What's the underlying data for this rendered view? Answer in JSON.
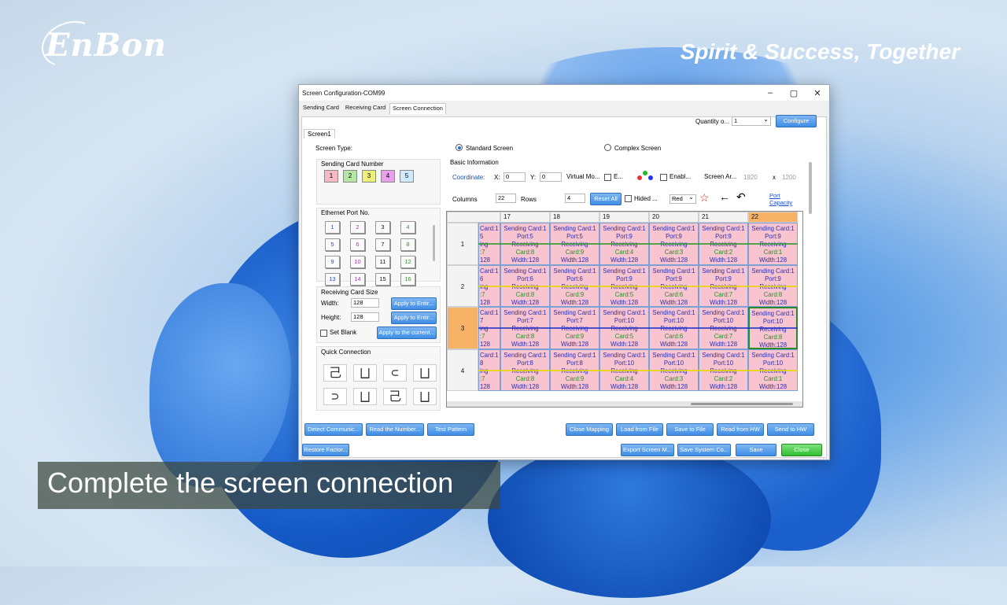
{
  "branding": {
    "logo": "EnBon",
    "tagline": "Spirit & Success, Together"
  },
  "subtitle": "Complete the screen connection",
  "window": {
    "title": "Screen Configuration-COM99",
    "minimize": "–",
    "maximize": "▢",
    "close": "✕",
    "tabs": [
      "Sending Card",
      "Receiving Card",
      "Screen Connection"
    ],
    "active_tab": 2
  },
  "top": {
    "quantity_label": "Quantity o...",
    "quantity_value": "1",
    "configure": "Configure",
    "screen_tab": "Screen1"
  },
  "screen_type": {
    "label": "Screen Type:",
    "standard": "Standard Screen",
    "complex": "Complex Screen"
  },
  "sending_card": {
    "label": "Sending Card Number",
    "numbers": [
      "1",
      "2",
      "3",
      "4",
      "5"
    ],
    "colors": [
      "#f8b8c4",
      "#b6e6a4",
      "#eef07a",
      "#e7a0ec",
      "#cfe9ff"
    ]
  },
  "ethernet": {
    "label": "Ethernet Port No.",
    "ports": [
      "1",
      "2",
      "3",
      "4",
      "5",
      "6",
      "7",
      "8",
      "9",
      "10",
      "11",
      "12",
      "13",
      "14",
      "15",
      "16"
    ],
    "colors": [
      "#1d4fd6",
      "#c22bd0",
      "#111",
      "#2a9a2a",
      "#1d4fd6",
      "#c22bd0",
      "#111",
      "#2a9a2a",
      "#1d4fd6",
      "#c22bd0",
      "#111",
      "#2a9a2a",
      "#1d4fd6",
      "#c22bd0",
      "#111",
      "#2a9a2a"
    ]
  },
  "rc_size": {
    "label": "Receiving Card Size",
    "width_label": "Width:",
    "width": "128",
    "height_label": "Height:",
    "height": "128",
    "apply_entire": "Apply to Entir...",
    "set_blank": "Set Blank",
    "apply_current": "Apply to the current..."
  },
  "quick": {
    "label": "Quick Connection",
    "glyphs": [
      "己",
      "⨆",
      "⊂",
      "⨆",
      "⊃",
      "⨆",
      "己",
      "⨆"
    ]
  },
  "basic": {
    "label": "Basic Information",
    "coordinate": "Coordinate:",
    "x_label": "X:",
    "x": "0",
    "y_label": "Y:",
    "y": "0",
    "virtual": "Virtual Mo...",
    "e": "E...",
    "enable": "Enabl...",
    "screen_area": "Screen Ar...",
    "sw": "1920",
    "x_sep": "x",
    "sh": "1200",
    "columns_label": "Columns",
    "columns": "22",
    "rows_label": "Rows",
    "rows": "4",
    "reset_all": "Reset All",
    "hided": "Hided ...",
    "color_sel": "Red",
    "port_capacity": "Port Capacity"
  },
  "grid": {
    "col_headers": [
      "",
      "17",
      "18",
      "19",
      "20",
      "21",
      "22"
    ],
    "row_headers": [
      "1",
      "2",
      "3",
      "4"
    ],
    "rows": [
      [
        [
          "Card:1",
          "5",
          "ing",
          ":7",
          "128"
        ],
        [
          "Sending Card:1",
          "Port:5",
          "Receiving",
          "Card:8",
          "Width:128"
        ],
        [
          "Sending Card:1",
          "Port:5",
          "Receiving",
          "Card:9",
          "Width:128"
        ],
        [
          "Sending Card:1",
          "Port:9",
          "Receiving",
          "Card:4",
          "Width:128"
        ],
        [
          "Sending Card:1",
          "Port:9",
          "Receiving",
          "Card:3",
          "Width:128"
        ],
        [
          "Sending Card:1",
          "Port:9",
          "Receiving",
          "Card:2",
          "Width:128"
        ],
        [
          "Sending Card:1",
          "Port:9",
          "Receiving",
          "Card:1",
          "Width:128"
        ]
      ],
      [
        [
          "Card:1",
          "6",
          "ing",
          ":7",
          "128"
        ],
        [
          "Sending Card:1",
          "Port:6",
          "Receiving",
          "Card:8",
          "Width:128"
        ],
        [
          "Sending Card:1",
          "Port:6",
          "Receiving",
          "Card:9",
          "Width:128"
        ],
        [
          "Sending Card:1",
          "Port:9",
          "Receiving",
          "Card:5",
          "Width:128"
        ],
        [
          "Sending Card:1",
          "Port:9",
          "Receiving",
          "Card:6",
          "Width:128"
        ],
        [
          "Sending Card:1",
          "Port:9",
          "Receiving",
          "Card:7",
          "Width:128"
        ],
        [
          "Sending Card:1",
          "Port:9",
          "Receiving",
          "Card:8",
          "Width:128"
        ]
      ],
      [
        [
          "Card:1",
          "7",
          "ing",
          ":7",
          "128"
        ],
        [
          "Sending Card:1",
          "Port:7",
          "Receiving",
          "Card:8",
          "Width:128"
        ],
        [
          "Sending Card:1",
          "Port:7",
          "Receiving",
          "Card:9",
          "Width:128"
        ],
        [
          "Sending Card:1",
          "Port:10",
          "Receiving",
          "Card:5",
          "Width:128"
        ],
        [
          "Sending Card:1",
          "Port:10",
          "Receiving",
          "Card:6",
          "Width:128"
        ],
        [
          "Sending Card:1",
          "Port:10",
          "Receiving",
          "Card:7",
          "Width:128"
        ],
        [
          "Sending Card:1",
          "Port:10",
          "Receiving",
          "Card:8",
          "Width:128"
        ]
      ],
      [
        [
          "Card:1",
          "8",
          "ing",
          ":7",
          "128"
        ],
        [
          "Sending Card:1",
          "Port:8",
          "Receiving",
          "Card:8",
          "Width:128"
        ],
        [
          "Sending Card:1",
          "Port:8",
          "Receiving",
          "Card:9",
          "Width:128"
        ],
        [
          "Sending Card:1",
          "Port:10",
          "Receiving",
          "Card:4",
          "Width:128"
        ],
        [
          "Sending Card:1",
          "Port:10",
          "Receiving",
          "Card:3",
          "Width:128"
        ],
        [
          "Sending Card:1",
          "Port:10",
          "Receiving",
          "Card:2",
          "Width:128"
        ],
        [
          "Sending Card:1",
          "Port:10",
          "Receiving",
          "Card:1",
          "Width:128"
        ]
      ]
    ]
  },
  "bottom": {
    "detect": "Detect Communic...",
    "read_number": "Read the Number...",
    "test_pattern": "Test Pattern",
    "close_mapping": "Close Mapping",
    "load": "Load from File",
    "save_file": "Save to File",
    "read_hw": "Read from HW",
    "send_hw": "Send to HW",
    "restore": "Restore Factor...",
    "export": "Export Screen M...",
    "save_system": "Save System Co...",
    "save": "Save",
    "close": "Close"
  }
}
